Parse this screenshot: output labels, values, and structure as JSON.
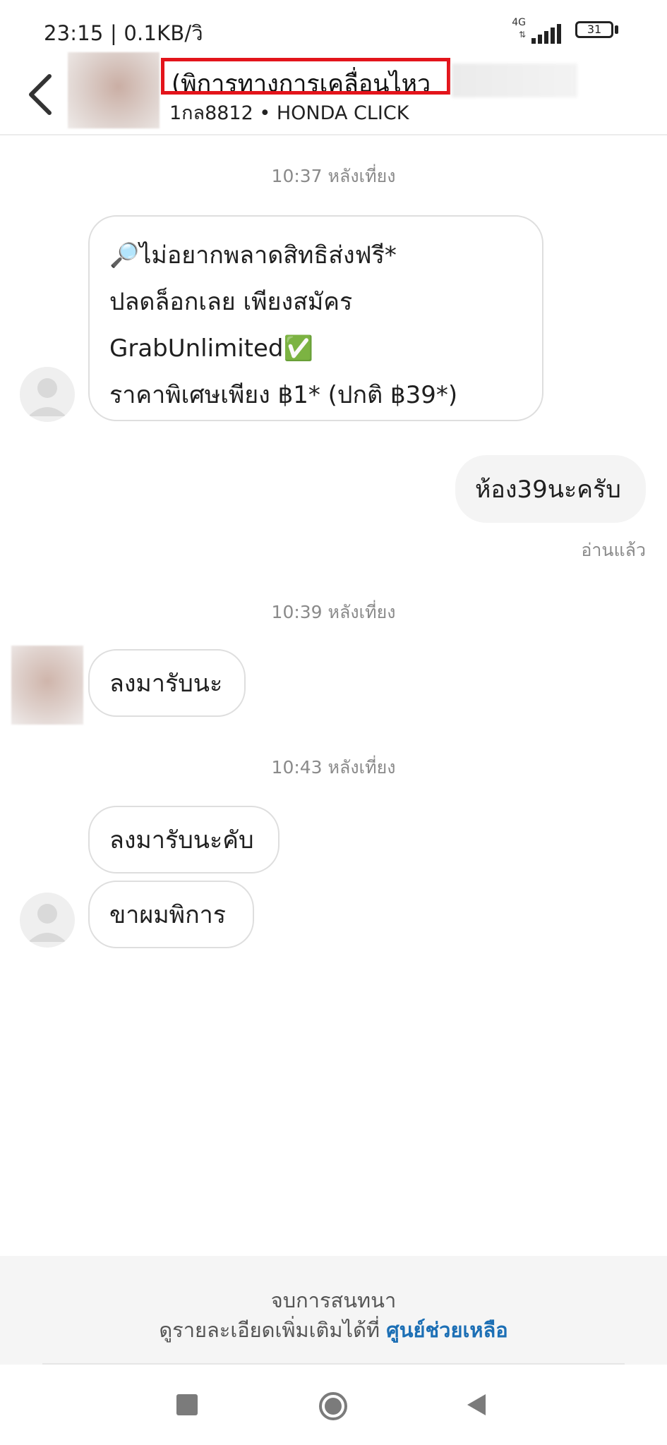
{
  "status_bar": {
    "time": "23:15 | 0.1KB/วิ",
    "network": "4G",
    "battery": "31"
  },
  "header": {
    "title": "(พิการทางการเคลื่อนไหว",
    "subtitle": "1กล8812 • HONDA CLICK"
  },
  "messages": {
    "time_1": "10:37 หลังเที่ยง",
    "promo_lines": [
      "🔎ไม่อยากพลาดสิทธิส่งฟรี*",
      "ปลดล็อกเลย เพียงสมัคร",
      "GrabUnlimited✅",
      "ราคาพิเศษเพียง ฿1* (ปกติ ฿39*)"
    ],
    "outgoing_1": "ห้อง39นะครับ",
    "read_status": "อ่านแล้ว",
    "time_2": "10:39 หลังเที่ยง",
    "incoming_2": "ลงมารับนะ",
    "time_3": "10:43 หลังเที่ยง",
    "incoming_3": "ลงมารับนะคับ",
    "incoming_4": "ขาผมพิการ"
  },
  "footer": {
    "end_text": "จบการสนทนา",
    "detail_text": "ดูรายละเอียดเพิ่มเติมได้ที่ ",
    "help_link": "ศูนย์ช่วยเหลือ"
  },
  "colors": {
    "highlight_box": "#e3141b",
    "link": "#1c6fb5",
    "timestamp": "#8a8a8a"
  }
}
